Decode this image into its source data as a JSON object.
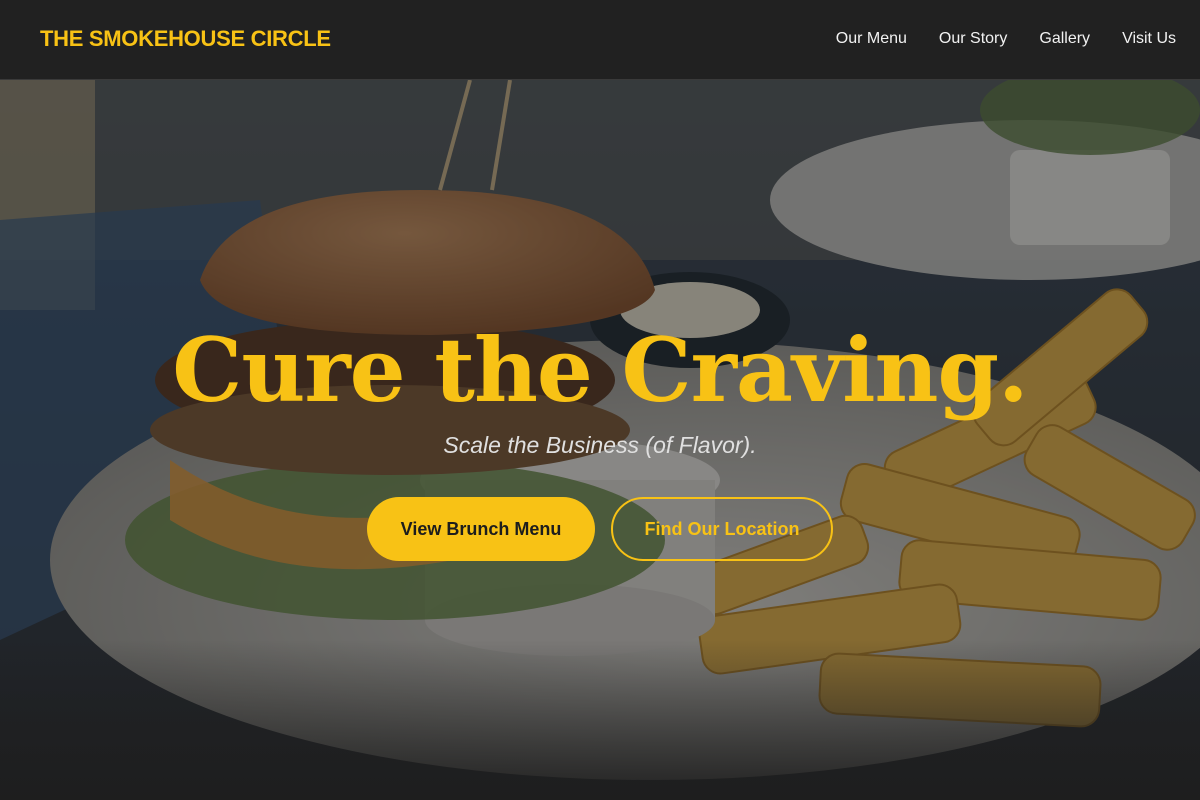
{
  "brand": {
    "name": "THE SMOKEHOUSE CIRCLE"
  },
  "nav": {
    "items": [
      {
        "label": "Our Menu"
      },
      {
        "label": "Our Story"
      },
      {
        "label": "Gallery"
      },
      {
        "label": "Visit Us"
      }
    ]
  },
  "hero": {
    "headline": "Cure the Craving.",
    "tagline": "Scale the Business (of Flavor).",
    "primary_button": "View Brunch Menu",
    "secondary_button": "Find Our Location"
  },
  "colors": {
    "accent": "#f8c215",
    "header_bg": "#212121",
    "page_bg": "#1e1e1e"
  }
}
